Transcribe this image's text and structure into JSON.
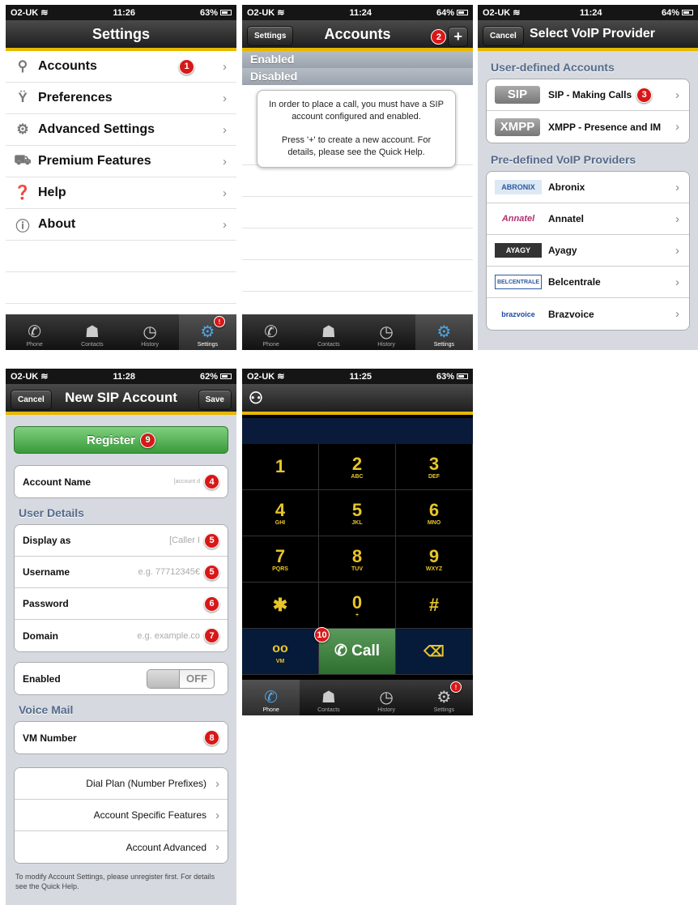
{
  "status": {
    "carrier": "O2-UK",
    "s1_time": "11:26",
    "s1_batt": "63%",
    "s2_time": "11:24",
    "s2_batt": "64%",
    "s3_time": "11:24",
    "s3_batt": "64%",
    "s4_time": "11:28",
    "s4_batt": "62%",
    "s5_time": "11:25",
    "s5_batt": "63%"
  },
  "settings": {
    "title": "Settings",
    "items": [
      {
        "label": "Accounts",
        "icon": "accounts-icon",
        "badge": "1"
      },
      {
        "label": "Preferences",
        "icon": "preferences-icon"
      },
      {
        "label": "Advanced Settings",
        "icon": "gears-icon"
      },
      {
        "label": "Premium Features",
        "icon": "cart-icon"
      },
      {
        "label": "Help",
        "icon": "help-icon"
      },
      {
        "label": "About",
        "icon": "info-icon"
      }
    ]
  },
  "tabs": {
    "phone": "Phone",
    "contacts": "Contacts",
    "history": "History",
    "settings": "Settings",
    "badge": "!"
  },
  "accounts": {
    "title": "Accounts",
    "back": "Settings",
    "plus": "+",
    "badge": "2",
    "enabled": "Enabled",
    "disabled": "Disabled",
    "msg1": "In order to place a call, you must have a SIP account configured and enabled.",
    "msg2": "Press '+' to create a new account. For details, please see the Quick Help."
  },
  "voip": {
    "title": "Select VoIP Provider",
    "cancel": "Cancel",
    "user_defined": "User-defined Accounts",
    "sip_tag": "SIP",
    "sip_label": "SIP - Making Calls",
    "sip_badge": "3",
    "xmpp_tag": "XMPP",
    "xmpp_label": "XMPP - Presence and IM",
    "predefined": "Pre-defined VoIP Providers",
    "providers": [
      "Abronix",
      "Annatel",
      "Ayagy",
      "Belcentrale",
      "Brazvoice"
    ]
  },
  "newsip": {
    "title": "New SIP Account",
    "cancel": "Cancel",
    "save": "Save",
    "register": "Register",
    "register_badge": "9",
    "account_name": "Account Name",
    "account_ph": "[account d",
    "account_badge": "4",
    "user_details": "User Details",
    "display_as": "Display as",
    "display_ph": "[Caller I",
    "display_badge": "5",
    "username": "Username",
    "username_ph": "e.g. 77712345€",
    "username_badge": "5",
    "password": "Password",
    "password_badge": "6",
    "domain": "Domain",
    "domain_ph": "e.g. example.co",
    "domain_badge": "7",
    "enabled": "Enabled",
    "toggle": "OFF",
    "voice_mail": "Voice Mail",
    "vm_number": "VM Number",
    "vm_badge": "8",
    "dial_plan": "Dial Plan (Number Prefixes)",
    "specific": "Account Specific Features",
    "advanced": "Account Advanced",
    "footnote": "To modify Account Settings, please unregister first.  For details see the Quick Help."
  },
  "dialer": {
    "keys": [
      {
        "d": "1",
        "l": ""
      },
      {
        "d": "2",
        "l": "ABC"
      },
      {
        "d": "3",
        "l": "DEF"
      },
      {
        "d": "4",
        "l": "GHI"
      },
      {
        "d": "5",
        "l": "JKL"
      },
      {
        "d": "6",
        "l": "MNO"
      },
      {
        "d": "7",
        "l": "PQRS"
      },
      {
        "d": "8",
        "l": "TUV"
      },
      {
        "d": "9",
        "l": "WXYZ"
      },
      {
        "d": "✱",
        "l": ""
      },
      {
        "d": "0",
        "l": "+"
      },
      {
        "d": "#",
        "l": ""
      }
    ],
    "vm": "VM",
    "call": "Call",
    "call_badge": "10"
  }
}
